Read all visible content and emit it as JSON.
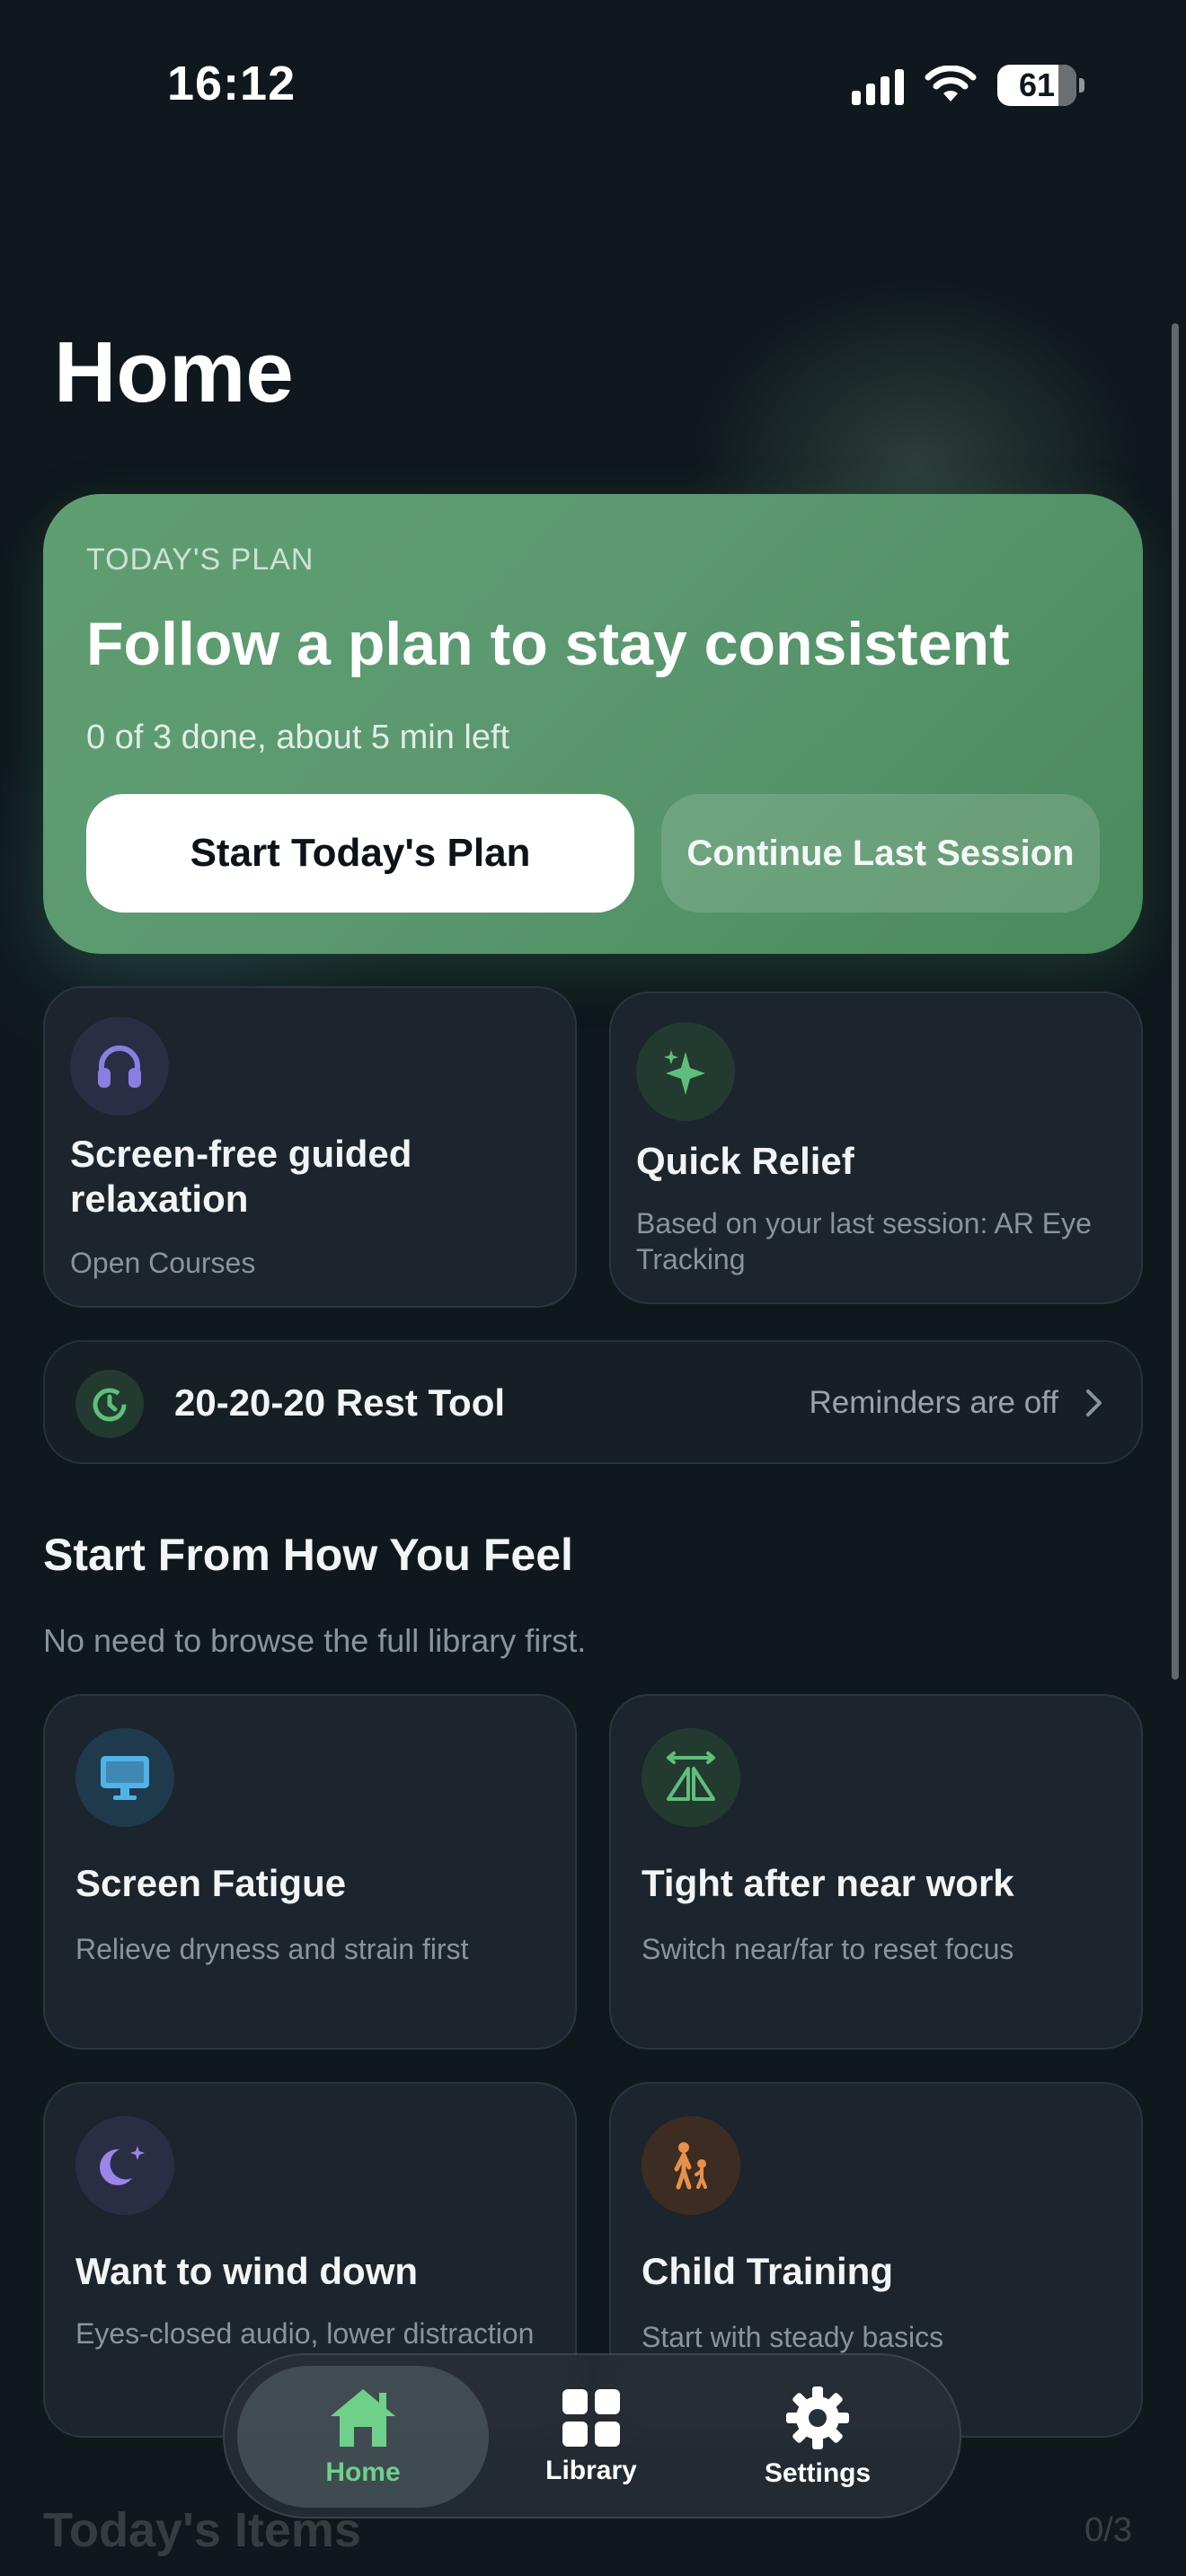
{
  "status_bar": {
    "time": "16:12",
    "battery": "61"
  },
  "page": {
    "title": "Home"
  },
  "todays_plan": {
    "kicker": "TODAY'S PLAN",
    "title": "Follow a plan to stay consistent",
    "progress": "0 of 3 done, about 5 min left",
    "primary_button": "Start Today's Plan",
    "secondary_button": "Continue Last Session"
  },
  "quick_cards": [
    {
      "title": "Screen-free guided relaxation",
      "subtitle": "Open Courses",
      "icon": "headphones-icon",
      "color": "#8a7fe0"
    },
    {
      "title": "Quick Relief",
      "subtitle": "Based on your last session: AR Eye Tracking",
      "icon": "sparkle-icon",
      "color": "#5fbf7a"
    }
  ],
  "rest_tool": {
    "title": "20-20-20 Rest Tool",
    "status": "Reminders are off",
    "icon": "timer-icon"
  },
  "feel_section": {
    "title": "Start From How You Feel",
    "subtitle": "No need to browse the full library first.",
    "items": [
      {
        "title": "Screen Fatigue",
        "subtitle": "Relieve dryness and strain first",
        "icon": "monitor-icon",
        "color": "#4fb3e8"
      },
      {
        "title": "Tight after near work",
        "subtitle": "Switch near/far to reset focus",
        "icon": "focus-shift-icon",
        "color": "#5fbf7a"
      },
      {
        "title": "Want to wind down",
        "subtitle": "Eyes-closed audio, lower distraction",
        "icon": "moon-icon",
        "color": "#9a86e8"
      },
      {
        "title": "Child Training",
        "subtitle": "Start with steady basics",
        "icon": "child-icon",
        "color": "#e8904a"
      }
    ]
  },
  "tabbar": [
    {
      "label": "Home",
      "icon": "home-icon",
      "selected": true
    },
    {
      "label": "Library",
      "icon": "grid-icon",
      "selected": false
    },
    {
      "label": "Settings",
      "icon": "gear-icon",
      "selected": false
    }
  ],
  "todays_items": {
    "title": "Today's Items",
    "count": "0/3"
  }
}
